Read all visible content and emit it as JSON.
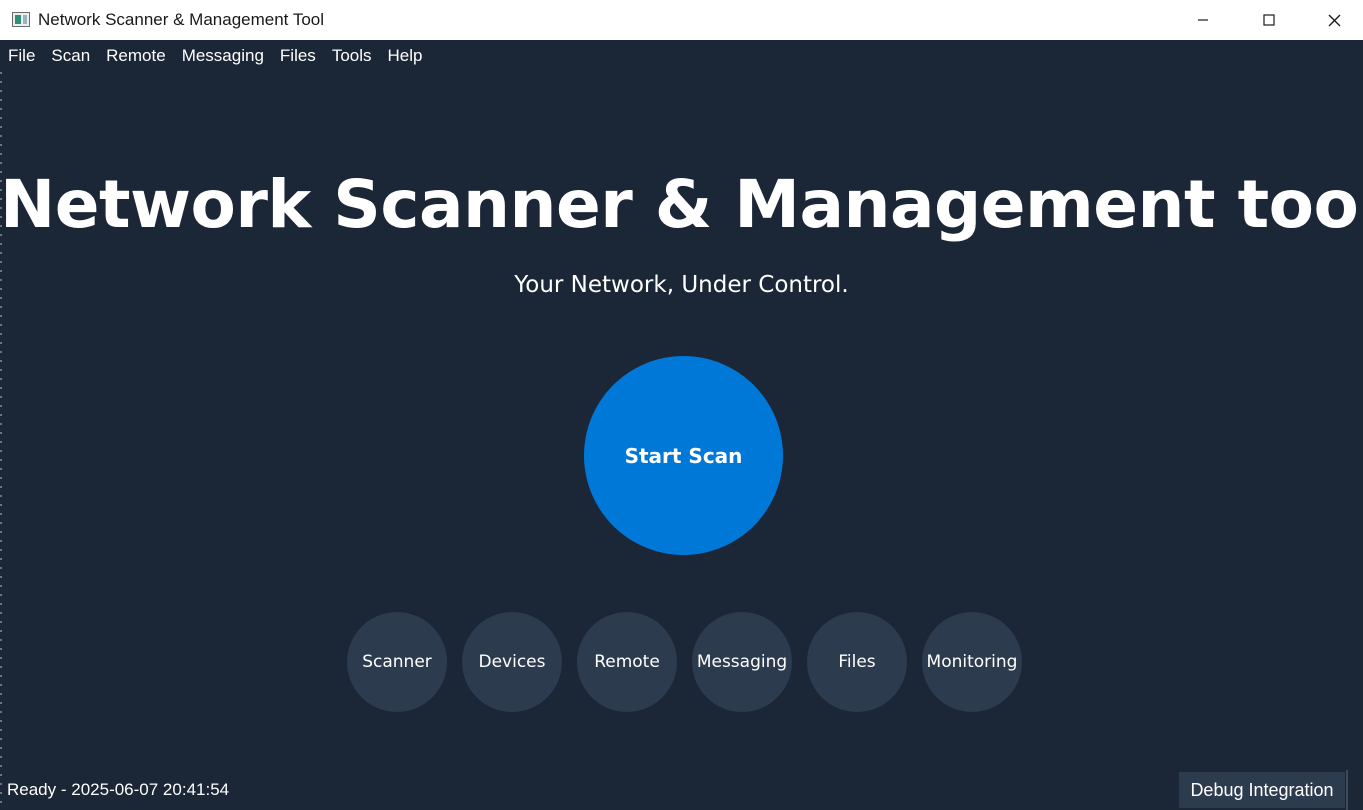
{
  "window": {
    "title": "Network Scanner & Management Tool",
    "app_icon": "app-window-icon"
  },
  "menubar": {
    "items": [
      {
        "label": "File"
      },
      {
        "label": "Scan"
      },
      {
        "label": "Remote"
      },
      {
        "label": "Messaging"
      },
      {
        "label": "Files"
      },
      {
        "label": "Tools"
      },
      {
        "label": "Help"
      }
    ]
  },
  "hero": {
    "title": "Network Scanner & Management tool",
    "subtitle": "Your Network, Under Control."
  },
  "start_scan": {
    "label": "Start Scan"
  },
  "nav": {
    "items": [
      {
        "label": "Scanner"
      },
      {
        "label": "Devices"
      },
      {
        "label": "Remote"
      },
      {
        "label": "Messaging"
      },
      {
        "label": "Files"
      },
      {
        "label": "Monitoring"
      }
    ]
  },
  "statusbar": {
    "status": "Ready - 2025-06-07 20:41:54",
    "debug_label": "Debug Integration"
  },
  "colors": {
    "background": "#1b2636",
    "accent": "#0078d7",
    "circle_button": "#2d3b4f",
    "text": "#ffffff"
  }
}
